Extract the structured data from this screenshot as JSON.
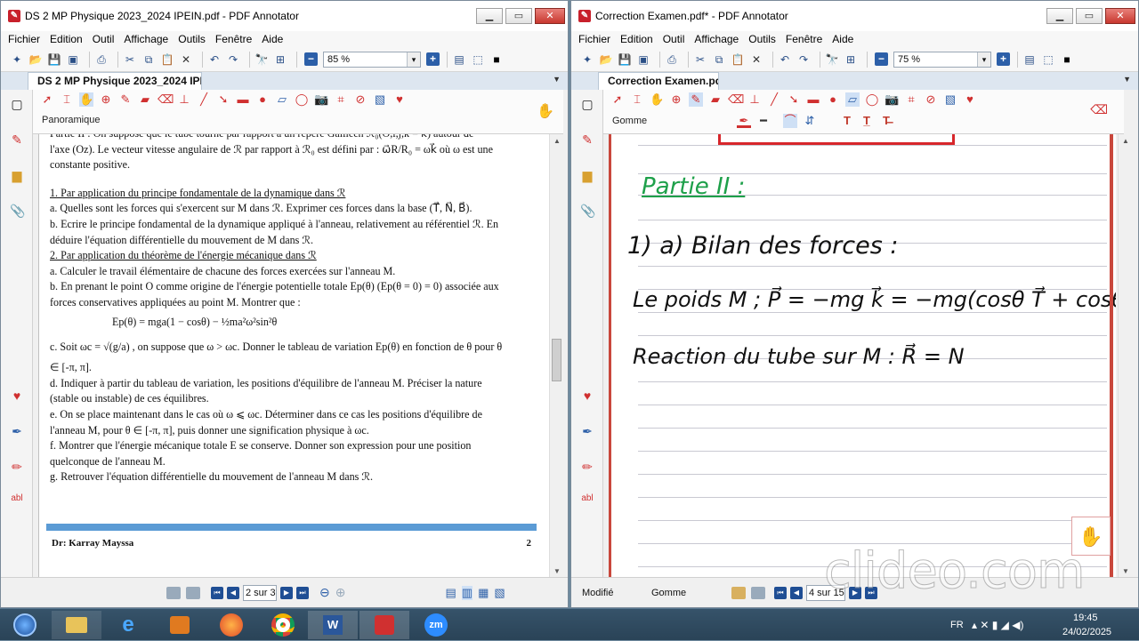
{
  "left": {
    "title": "DS 2 MP Physique 2023_2024 IPEIN.pdf - PDF Annotator",
    "menu": [
      "Fichier",
      "Edition",
      "Outil",
      "Affichage",
      "Outils",
      "Fenêtre",
      "Aide"
    ],
    "zoom": "85 %",
    "tab": "DS 2 MP Physique 2023_2024 IPEI...",
    "tool_label": "Panoramique",
    "doc": {
      "l1": "Partie II : On suppose que le tube tourne par rapport à un repère Galiléen ℛ₀(O,î,ĵ,k̂ = k⃗) autour de",
      "l2": "l'axe (Oz). Le vecteur vitesse angulaire de ℛ par rapport à ℛ₀ est défini par : ω⃗R/R₀ = ωk⃗ où ω est une",
      "l3": "constante positive.",
      "h1": "1. Par application du principe fondamentale de la dynamique dans ℛ",
      "a1": "a. Quelles sont les forces qui s'exercent sur M dans ℛ. Exprimer ces forces dans la base (T⃗, N⃗, B⃗).",
      "b1": "b. Ecrire le principe fondamental de la dynamique appliqué à l'anneau, relativement au référentiel ℛ. En",
      "b1b": "déduire l'équation différentielle du mouvement de M dans ℛ.",
      "h2": "2. Par application du théorème de l'énergie mécanique dans ℛ",
      "a2": "a. Calculer le travail élémentaire de chacune des forces exercées sur l'anneau M.",
      "b2": "b. En prenant le point O comme origine de l'énergie potentielle totale Ep(θ) (Ep(θ = 0) = 0) associée aux",
      "b2b": "forces conservatives appliquées au point M. Montrer que :",
      "eq": "Ep(θ) = mga(1 − cosθ) − ½ma²ω²sin²θ",
      "c2": "c. Soit ωc = √(g/a) , on suppose que ω > ωc. Donner le tableau de variation Ep(θ) en fonction de θ pour θ",
      "c2b": "∈ [-π, π].",
      "d2": "d. Indiquer à partir du tableau de variation, les positions d'équilibre de l'anneau M. Préciser la nature",
      "d2b": "(stable ou instable) de ces équilibres.",
      "e2": "e. On se place maintenant dans le cas où ω ⩽ ωc. Déterminer dans ce cas les positions d'équilibre de",
      "e2b": "l'anneau M, pour θ ∈ [-π, π], puis donner une signification physique à ωc.",
      "f2": "f. Montrer que l'énergie mécanique totale E se conserve. Donner son expression pour une position",
      "f2b": "quelconque de l'anneau M.",
      "g2": "g. Retrouver l'équation différentielle du mouvement de l'anneau M dans ℛ.",
      "footer_author": "Dr: Karray Mayssa",
      "footer_page": "2"
    },
    "page_indicator": "2 sur 3"
  },
  "right": {
    "title": "Correction Examen.pdf* - PDF Annotator",
    "menu": [
      "Fichier",
      "Edition",
      "Outil",
      "Affichage",
      "Outils",
      "Fenêtre",
      "Aide"
    ],
    "zoom": "75 %",
    "tab": "Correction Examen.pdf*",
    "tool_label": "Gomme",
    "hw": {
      "partie": "Partie II :",
      "l1": "1) a) Bilan des forces :",
      "l2": "Le poids M ; P⃗ = −mg k⃗ = −mg(cosθ T⃗ + cosθ",
      "l3": "Reaction du tube sur M : R⃗ = N"
    },
    "status_left": "Modifié",
    "status_tool": "Gomme",
    "page_indicator": "4 sur 15"
  },
  "watermark": "clideo.com",
  "taskbar": {
    "lang": "FR",
    "time": "19:45",
    "date": "24/02/2025"
  },
  "colors": {
    "accent": "#2c5fa8",
    "hw_green": "#1ea04a",
    "frame_red": "#d7262b"
  }
}
